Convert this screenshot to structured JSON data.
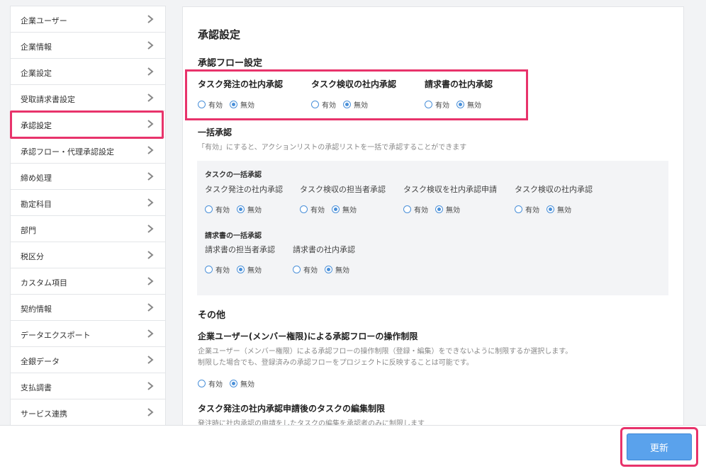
{
  "sidebar": {
    "items": [
      {
        "label": "企業ユーザー"
      },
      {
        "label": "企業情報"
      },
      {
        "label": "企業設定"
      },
      {
        "label": "受取請求書設定"
      },
      {
        "label": "承認設定"
      },
      {
        "label": "承認フロー・代理承認設定"
      },
      {
        "label": "締め処理"
      },
      {
        "label": "勘定科目"
      },
      {
        "label": "部門"
      },
      {
        "label": "税区分"
      },
      {
        "label": "カスタム項目"
      },
      {
        "label": "契約情報"
      },
      {
        "label": "データエクスポート"
      },
      {
        "label": "全銀データ"
      },
      {
        "label": "支払調書"
      },
      {
        "label": "サービス連携"
      }
    ],
    "active_index": 4
  },
  "main": {
    "title": "承認設定",
    "flow_section": {
      "title": "承認フロー設定",
      "groups": [
        {
          "label": "タスク発注の社内承認",
          "options": [
            "有効",
            "無効"
          ],
          "selected": "無効"
        },
        {
          "label": "タスク検収の社内承認",
          "options": [
            "有効",
            "無効"
          ],
          "selected": "無効"
        },
        {
          "label": "請求書の社内承認",
          "options": [
            "有効",
            "無効"
          ],
          "selected": "無効"
        }
      ]
    },
    "bulk_section": {
      "title": "一括承認",
      "description": "「有効」にすると、アクションリストの承認リストを一括で承認することができます",
      "task_title": "タスクの一括承認",
      "task_items": [
        {
          "label": "タスク発注の社内承認",
          "options": [
            "有効",
            "無効"
          ],
          "selected": "無効"
        },
        {
          "label": "タスク検収の担当者承認",
          "options": [
            "有効",
            "無効"
          ],
          "selected": "無効"
        },
        {
          "label": "タスク検収を社内承認申請",
          "options": [
            "有効",
            "無効"
          ],
          "selected": "無効"
        },
        {
          "label": "タスク検収の社内承認",
          "options": [
            "有効",
            "無効"
          ],
          "selected": "無効"
        }
      ],
      "invoice_title": "請求書の一括承認",
      "invoice_items": [
        {
          "label": "請求書の担当者承認",
          "options": [
            "有効",
            "無効"
          ],
          "selected": "無効"
        },
        {
          "label": "請求書の社内承認",
          "options": [
            "有効",
            "無効"
          ],
          "selected": "無効"
        }
      ]
    },
    "other_section": {
      "title": "その他",
      "restriction": {
        "title": "企業ユーザー(メンバー権限)による承認フローの操作制限",
        "desc1": "企業ユーザー（メンバー権限）による承認フローの操作制限（登録・編集）をできないように制限するか選択します。",
        "desc2": "制限した場合でも、登録済みの承認フローをプロジェクトに反映することは可能です。",
        "options": [
          "有効",
          "無効"
        ],
        "selected": "無効"
      },
      "edit_restriction": {
        "title": "タスク発注の社内承認申請後のタスクの編集制限",
        "desc": "発注時に社内承認の申請をしたタスクの編集を承認者のみに制限します"
      }
    }
  },
  "footer": {
    "update_label": "更新"
  },
  "colors": {
    "accent": "#4a90d9",
    "button": "#5aa2ec",
    "highlight": "#e8336b"
  }
}
